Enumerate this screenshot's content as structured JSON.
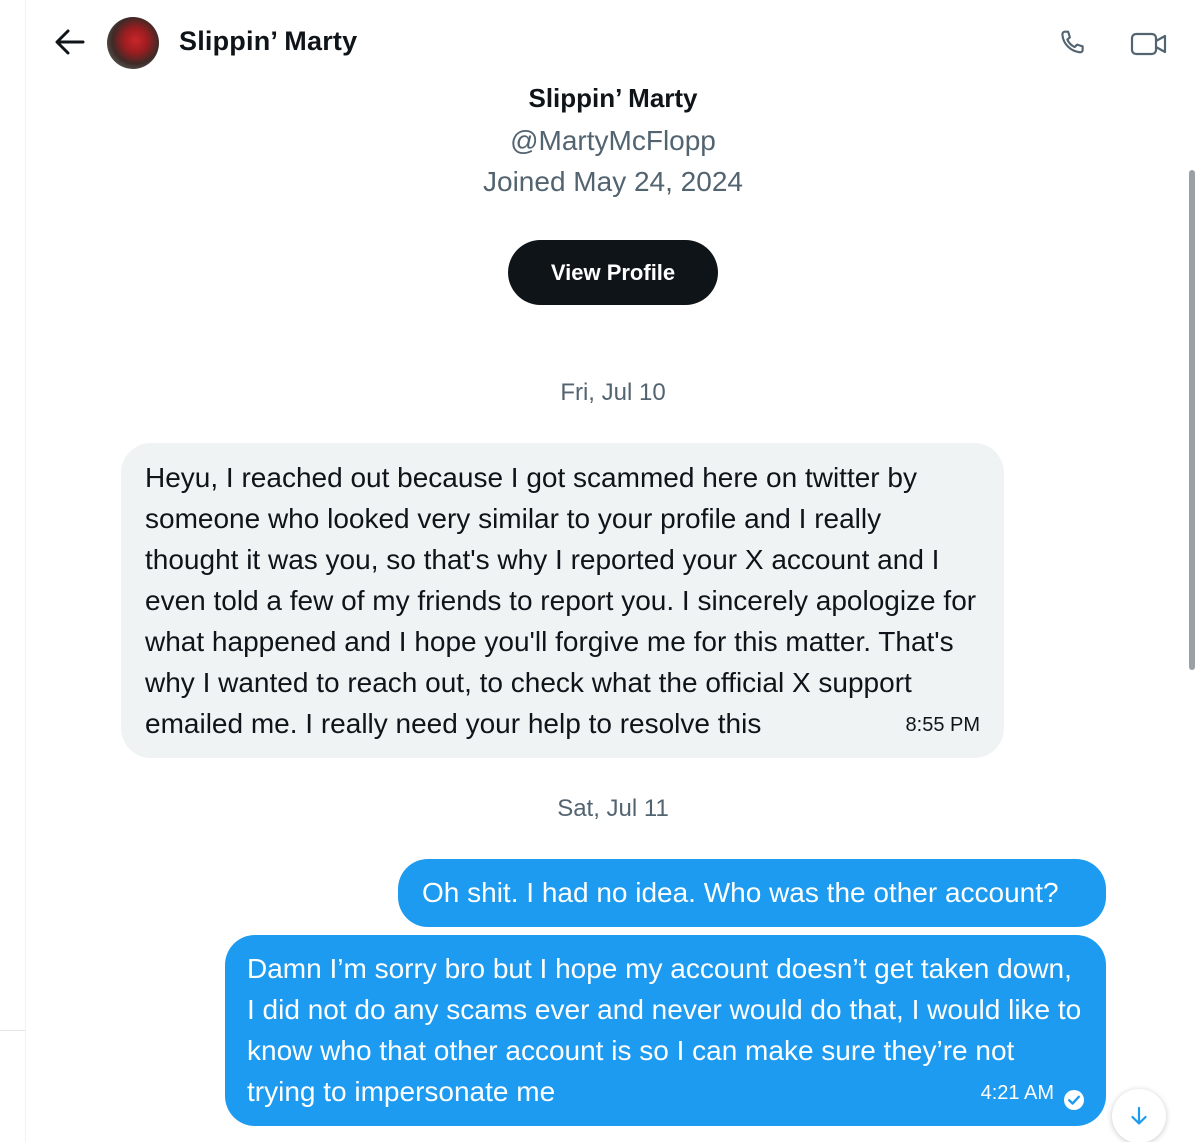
{
  "header": {
    "back_icon": "arrow-left-icon",
    "name": "Slippin’ Marty",
    "call_icon": "phone-icon",
    "video_icon": "video-camera-icon"
  },
  "profile": {
    "name": "Slippin’ Marty",
    "handle": "@MartyMcFlopp",
    "joined": "Joined May 24, 2024",
    "view_profile_label": "View Profile"
  },
  "conversation": {
    "day1": {
      "label": "Fri, Jul 10",
      "messages": [
        {
          "direction": "incoming",
          "text": "Heyu, I reached out because I got scammed here on twitter by someone who looked very similar to your profile and I really thought it was you, so that's why I reported your X account and I even told a few of my friends to report you. I sincerely apologize for what happened and I hope you'll forgive me for this matter. That's why I wanted to reach out, to check what the official X support emailed me. I really need your help to resolve this",
          "time": "8:55 PM"
        }
      ]
    },
    "day2": {
      "label": "Sat, Jul 11",
      "messages": [
        {
          "direction": "outgoing",
          "text": "Oh shit. I had no idea. Who was the other account?"
        },
        {
          "direction": "outgoing",
          "text": "Damn I’m sorry bro but I hope my account doesn’t get taken down, I did not do any scams ever and never would do that, I would like to know who that other account is so I can make sure they’re not trying to impersonate me",
          "time": "4:21 AM",
          "status_icon": "read-check-icon"
        }
      ]
    }
  },
  "scroll_down_icon": "arrow-down-icon",
  "colors": {
    "accent": "#1d9bf0",
    "incoming_bubble": "#eff3f4",
    "primary_button": "#0f1419",
    "secondary_text": "#536471"
  }
}
